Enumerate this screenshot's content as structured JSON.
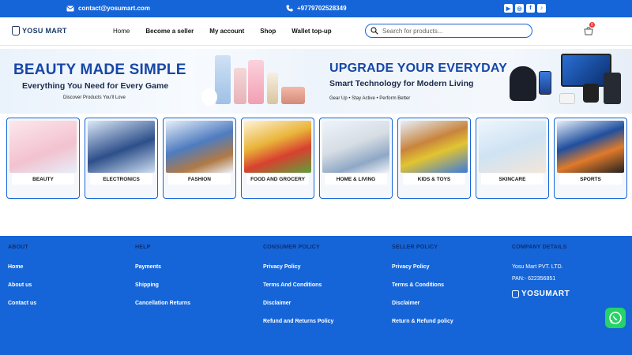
{
  "topbar": {
    "email": "contact@yosumart.com",
    "phone": "+9779702528349",
    "socials": [
      "youtube-icon",
      "instagram-icon",
      "facebook-icon",
      "tiktok-icon"
    ]
  },
  "nav": {
    "logo_text": "YOSU MART",
    "menu": [
      "Home",
      "Become a seller",
      "My account",
      "Shop",
      "Wallet top-up"
    ],
    "search_placeholder": "Search for products...",
    "cart_count": "0"
  },
  "banners": [
    {
      "title": "BEAUTY MADE SIMPLE",
      "subtitle": "Everything You Need for Every Game",
      "tagline": "Discover Products You'll Love"
    },
    {
      "title": "UPGRADE YOUR EVERYDAY",
      "subtitle": "Smart Technology for Modern Living",
      "tagline": "Gear Up • Stay Active • Perform Better"
    }
  ],
  "categories": [
    "BEAUTY",
    "ELECTRONICS",
    "FASHION",
    "FOOD AND GROCERY",
    "HOME & LIVING",
    "KIDS & TOYS",
    "SKINCARE",
    "SPORTS"
  ],
  "footer": {
    "about": {
      "head": "ABOUT",
      "links": [
        "Home",
        "About us",
        "Contact us"
      ]
    },
    "help": {
      "head": "HELP",
      "links": [
        "Payments",
        "Shipping",
        "Cancellation Returns"
      ]
    },
    "consumer": {
      "head": "CONSUMER POLICY",
      "links": [
        "Privacy Policy",
        "Terms And Conditions",
        "Disclaimer",
        "Refund and Returns Policy"
      ]
    },
    "seller": {
      "head": "SELLER POLICY",
      "links": [
        "Privacy Policy",
        "Terms & Conditions",
        "Disclaimer",
        "Return & Refund policy"
      ]
    },
    "company": {
      "head": "COMPANY DETAILS",
      "name": "Yosu Mart PVT. LTD.",
      "pan": "PAN:- 622356851",
      "logo_text": "YOSUMART"
    }
  },
  "colors": {
    "primary": "#1565d8",
    "dark_heading": "#0c2f74",
    "whatsapp": "#25d366"
  }
}
